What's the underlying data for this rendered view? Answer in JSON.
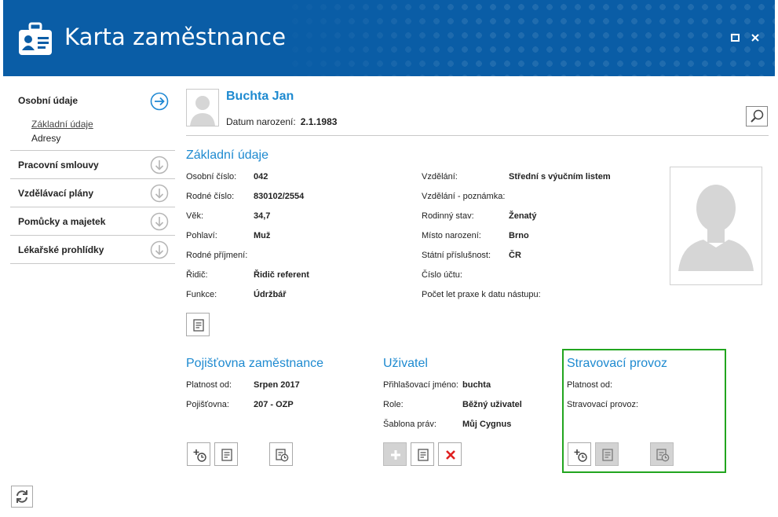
{
  "window": {
    "title": "Karta zaměstnance"
  },
  "sidebar": {
    "sections": [
      {
        "label": "Osobní údaje",
        "state": "expanded",
        "sub_items": [
          "Základní údaje",
          "Adresy"
        ]
      },
      {
        "label": "Pracovní smlouvy"
      },
      {
        "label": "Vzdělávací plány"
      },
      {
        "label": "Pomůcky a majetek"
      },
      {
        "label": "Lékařské prohlídky"
      }
    ]
  },
  "employee": {
    "name": "Buchta Jan",
    "dob_label": "Datum narození:",
    "dob_value": "2.1.1983"
  },
  "basic": {
    "title": "Základní údaje",
    "left": [
      {
        "label": "Osobní číslo:",
        "value": "042"
      },
      {
        "label": "Rodné číslo:",
        "value": "830102/2554"
      },
      {
        "label": "Věk:",
        "value": "34,7"
      },
      {
        "label": "Pohlaví:",
        "value": "Muž"
      },
      {
        "label": "Rodné příjmení:",
        "value": ""
      },
      {
        "label": "Řidič:",
        "value": "Řidič referent"
      },
      {
        "label": "Funkce:",
        "value": "Údržbář"
      }
    ],
    "right": [
      {
        "label": "Vzdělání:",
        "value": "Střední s výučním listem"
      },
      {
        "label": "Vzdělání - poznámka:",
        "value": ""
      },
      {
        "label": "Rodinný stav:",
        "value": "Ženatý"
      },
      {
        "label": "Místo narození:",
        "value": "Brno"
      },
      {
        "label": "Státní příslušnost:",
        "value": "ČR"
      },
      {
        "label": "Číslo účtu:",
        "value": ""
      },
      {
        "label": "Počet let praxe k datu nástupu:",
        "value": ""
      }
    ]
  },
  "insurance": {
    "title": "Pojišťovna zaměstnance",
    "rows": [
      {
        "label": "Platnost od:",
        "value": "Srpen 2017"
      },
      {
        "label": "Pojišťovna:",
        "value": "207 - OZP"
      }
    ]
  },
  "user": {
    "title": "Uživatel",
    "rows": [
      {
        "label": "Přihlašovací jméno:",
        "value": "buchta"
      },
      {
        "label": "Role:",
        "value": "Běžný uživatel"
      },
      {
        "label": "Šablona práv:",
        "value": "Můj Cygnus"
      }
    ]
  },
  "canteen": {
    "title": "Stravovací provoz",
    "rows": [
      {
        "label": "Platnost od:",
        "value": ""
      },
      {
        "label": "Stravovací provoz:",
        "value": ""
      }
    ]
  },
  "colors": {
    "titlebar": "#0a5da6",
    "accent": "#1e8ad0",
    "highlight": "#22a51f",
    "delete": "#e02020"
  }
}
